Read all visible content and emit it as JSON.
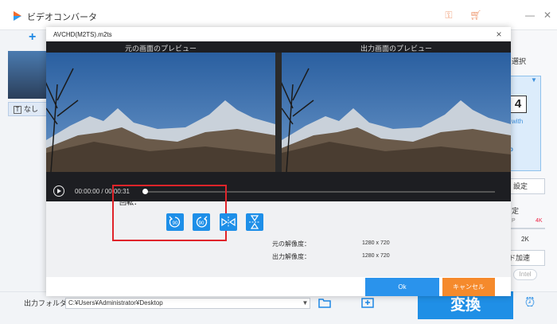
{
  "app": {
    "title": "ビデオコンバータ",
    "add_label": "+",
    "left_tag_icon": "T",
    "left_tag_label": "なし",
    "right_panel": {
      "select_label": "選択",
      "card_number": "4",
      "card_brand": "with",
      "card_letter": "p",
      "settings_label": "設定",
      "quality_label": "定",
      "res_low": "P",
      "res_high": "4K",
      "res_mid": "2K",
      "accel_label": "ド加速",
      "intel_label": "Intel"
    },
    "bottom": {
      "output_label": "出力フォルダ：",
      "output_path": "C:¥Users¥Administrator¥Desktop",
      "convert_label": "変換"
    },
    "icons": [
      "video-logo-icon",
      "key-icon",
      "cart-icon",
      "minimize-icon",
      "close-icon",
      "folder-icon",
      "folder-merge-icon",
      "alarm-icon"
    ]
  },
  "modal": {
    "title": "AVCHD(M2TS).m2ts",
    "close": "×",
    "preview": {
      "left_header": "元の画面のプレビュー",
      "right_header": "出力画面のプレビュー",
      "current_time": "00:00:00",
      "time_sep": "/",
      "duration": "00:00:31",
      "progress": 0
    },
    "rotate": {
      "label": "回転：",
      "buttons": [
        {
          "name": "rotate-left-90-icon",
          "text": "90"
        },
        {
          "name": "rotate-right-90-icon",
          "text": "90"
        },
        {
          "name": "flip-horizontal-icon",
          "text": ""
        },
        {
          "name": "flip-vertical-icon",
          "text": ""
        }
      ]
    },
    "resolution": {
      "original_label": "元の解像度：",
      "original_value": "1280 x 720",
      "output_label": "出力解像度：",
      "output_value": "1280 x 720"
    },
    "ok_label": "Ok",
    "cancel_label": "キャンセル"
  },
  "colors": {
    "accent": "#1f8fe6",
    "cancel": "#f58a2c",
    "highlight": "#e0242a"
  }
}
